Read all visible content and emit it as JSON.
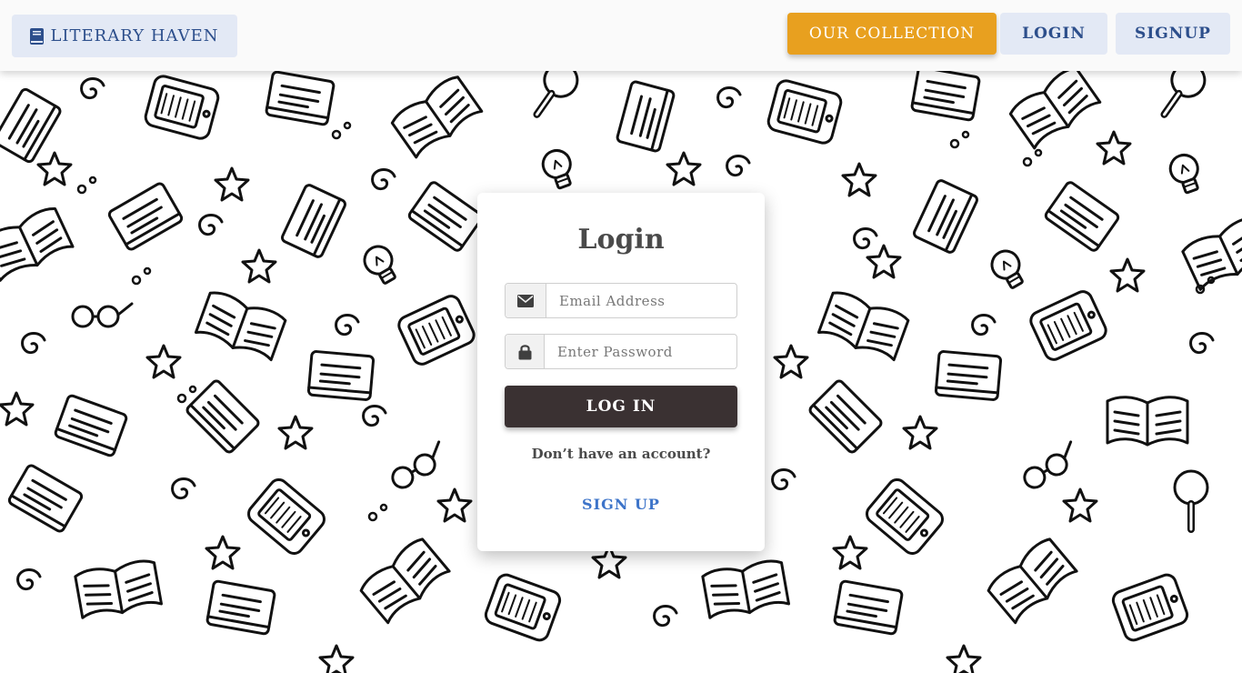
{
  "navbar": {
    "brand_label": "LITERARY HAVEN",
    "brand_icon": "book-icon",
    "collection_label": "OUR COLLECTION",
    "login_label": "LOGIN",
    "signup_label": "SIGNUP"
  },
  "login_card": {
    "title": "Login",
    "email": {
      "placeholder": "Email Address",
      "value": "",
      "icon": "envelope-icon"
    },
    "password": {
      "placeholder": "Enter Password",
      "value": "",
      "icon": "lock-icon"
    },
    "submit_label": "LOG IN",
    "no_account_text": "Don’t have an account?",
    "signup_link_label": "SIGN UP"
  },
  "colors": {
    "accent": "#e8a01f",
    "nav_button_bg": "#e3e9f5",
    "nav_text": "#2d4f8c",
    "submit_bg": "#3a3132",
    "link": "#3d74c9"
  }
}
